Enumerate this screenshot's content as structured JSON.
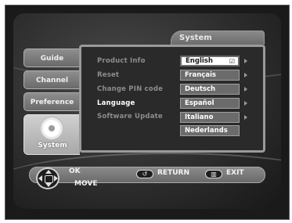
{
  "header": {
    "title": "System"
  },
  "sidebar": {
    "items": [
      {
        "label": "Guide"
      },
      {
        "label": "Channel"
      },
      {
        "label": "Preference"
      },
      {
        "label": "System"
      }
    ]
  },
  "menu": {
    "items": [
      {
        "label": "Product Info"
      },
      {
        "label": "Reset"
      },
      {
        "label": "Change PIN code"
      },
      {
        "label": "Language"
      },
      {
        "label": "Software Update"
      }
    ],
    "active_index": 3
  },
  "languages": {
    "options": [
      {
        "label": "English",
        "checkmark": "☑"
      },
      {
        "label": "Français"
      },
      {
        "label": "Deutsch"
      },
      {
        "label": "Español"
      },
      {
        "label": "Italiano"
      },
      {
        "label": "Nederlands"
      }
    ],
    "selected": "English"
  },
  "footer": {
    "ok_label": "OK",
    "move_label": "MOVE",
    "return_label": "RETURN",
    "exit_label": "EXIT",
    "return_icon": "return-arrow-icon",
    "exit_icon": "exit-icon"
  },
  "colors": {
    "panel_border": "#9a9a9a",
    "highlight": "#ffffff",
    "inactive_text": "#8c8c8c"
  }
}
